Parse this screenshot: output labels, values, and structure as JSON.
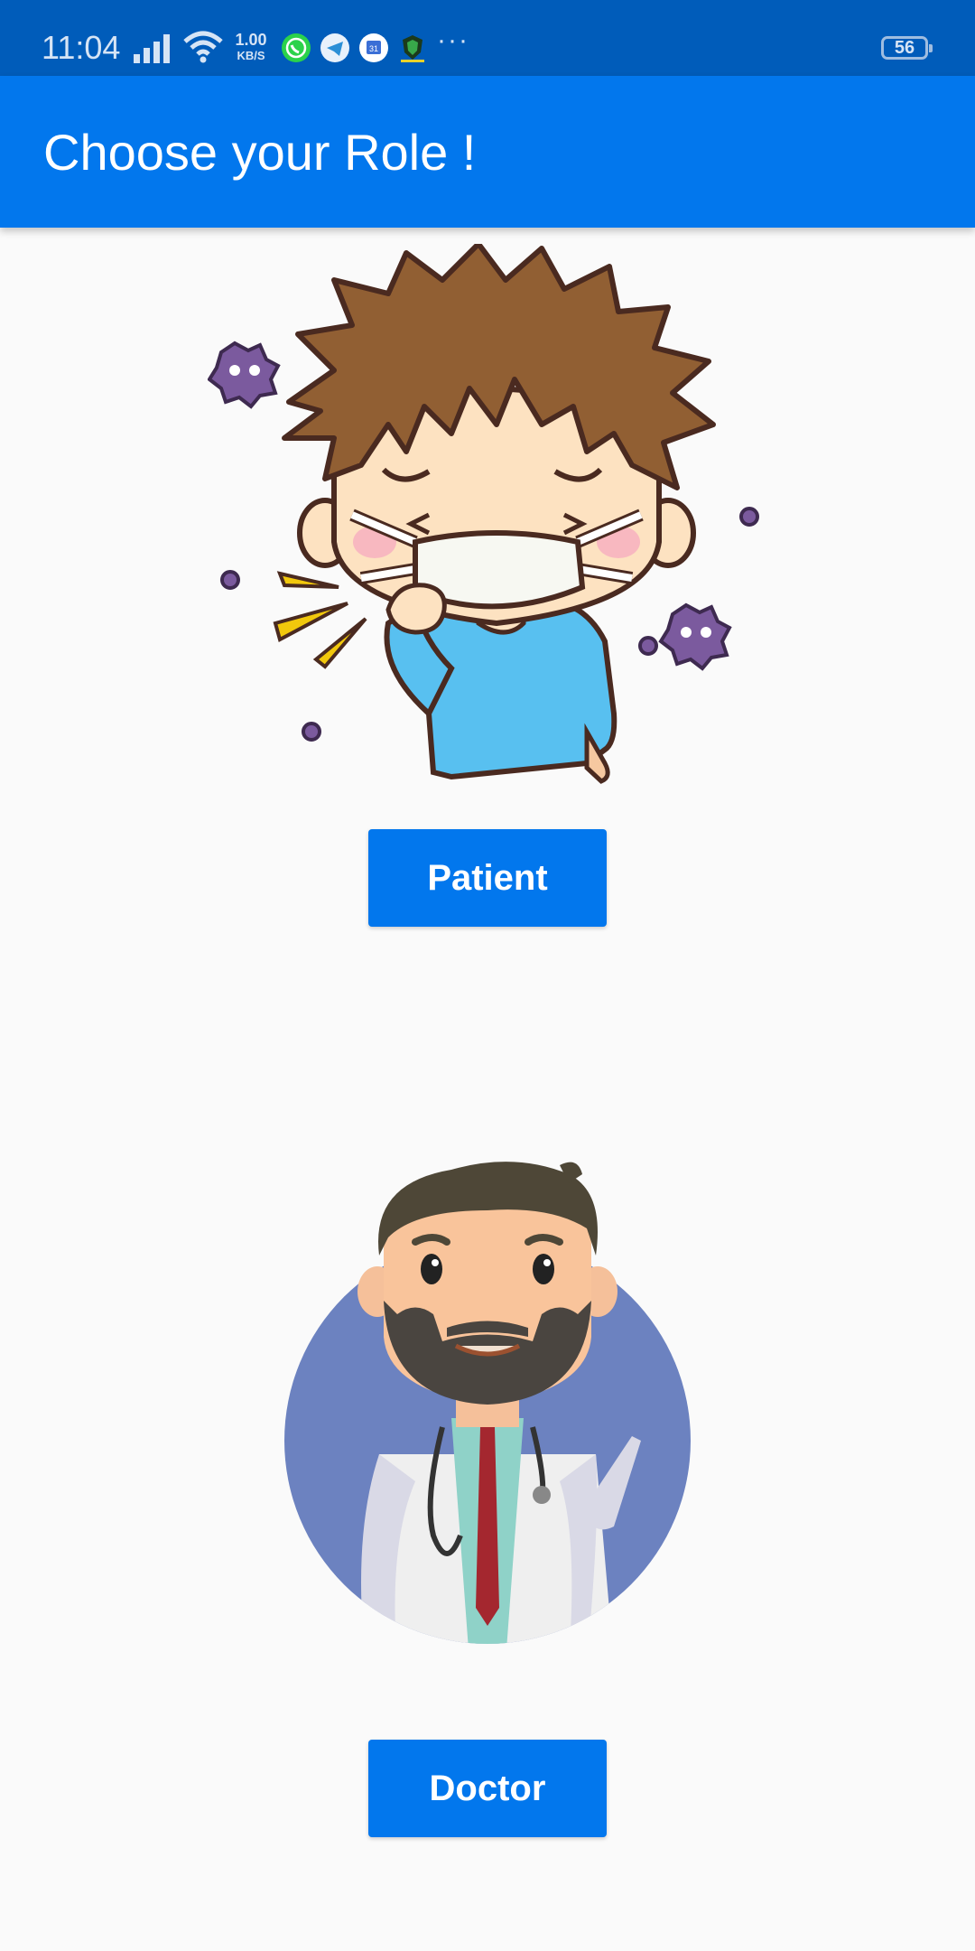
{
  "status_bar": {
    "time": "11:04",
    "net_speed_value": "1.00",
    "net_speed_unit": "KB/S",
    "battery_level": "56",
    "more_indicator": "···",
    "icons": [
      "signal-icon",
      "wifi-icon",
      "whatsapp-icon",
      "telegram-icon",
      "calendar-icon",
      "security-shield-icon"
    ]
  },
  "app_bar": {
    "title": "Choose your Role !"
  },
  "roles": {
    "patient": {
      "label": "Patient",
      "illustration": "sick-patient-illustration"
    },
    "doctor": {
      "label": "Doctor",
      "illustration": "doctor-illustration"
    }
  },
  "colors": {
    "status_bar": "#005cba",
    "app_bar": "#0277ed",
    "button": "#0277ed",
    "background": "#fafafa"
  }
}
